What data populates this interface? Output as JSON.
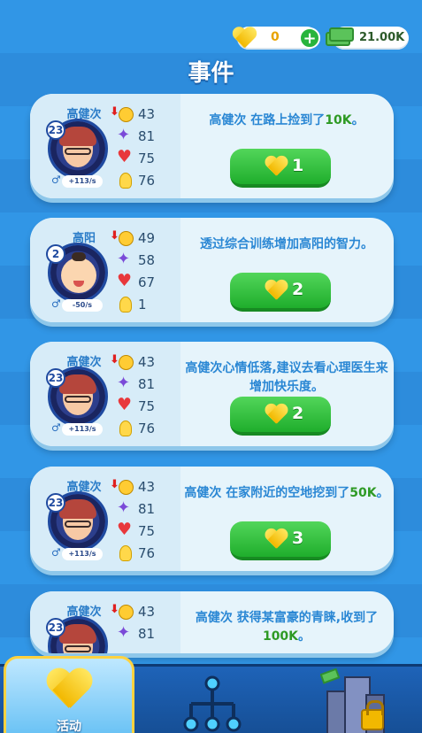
{
  "header": {
    "hearts_value": "0",
    "cash_value": "21.00K",
    "title": "事件"
  },
  "events": [
    {
      "name": "高健次",
      "level": "23",
      "rate": "+113/s",
      "avatar": "adult",
      "mood": "43",
      "intel": "81",
      "health": "75",
      "idea": "76",
      "desc_pre": "高健次 在路上捡到了",
      "desc_hl": "10K",
      "desc_post": "。",
      "cost": "1"
    },
    {
      "name": "高阳",
      "level": "2",
      "rate": "-50/s",
      "avatar": "baby",
      "mood": "49",
      "intel": "58",
      "health": "67",
      "idea": "1",
      "desc_pre": "透过综合训练增加高阳的智力。",
      "desc_hl": "",
      "desc_post": "",
      "cost": "2"
    },
    {
      "name": "高健次",
      "level": "23",
      "rate": "+113/s",
      "avatar": "adult",
      "mood": "43",
      "intel": "81",
      "health": "75",
      "idea": "76",
      "desc_pre": "高健次心情低落,建议去看心理医生来增加快乐度。",
      "desc_hl": "",
      "desc_post": "",
      "cost": "2"
    },
    {
      "name": "高健次",
      "level": "23",
      "rate": "+113/s",
      "avatar": "adult",
      "mood": "43",
      "intel": "81",
      "health": "75",
      "idea": "76",
      "desc_pre": "高健次 在家附近的空地挖到了",
      "desc_hl": "50K",
      "desc_post": "。",
      "cost": "3"
    },
    {
      "name": "高健次",
      "level": "23",
      "rate": "",
      "avatar": "adult",
      "mood": "43",
      "intel": "81",
      "health": "",
      "idea": "",
      "desc_pre": "高健次 获得某富豪的青睐,收到了",
      "desc_hl": "100K",
      "desc_post": "。",
      "cost": ""
    }
  ],
  "nav": {
    "activity_label": "活动"
  },
  "colors": {
    "accent_blue": "#2a87d4",
    "highlight_green": "#2e9a24",
    "button_green": "#1fae2c",
    "gold": "#f2b800"
  }
}
